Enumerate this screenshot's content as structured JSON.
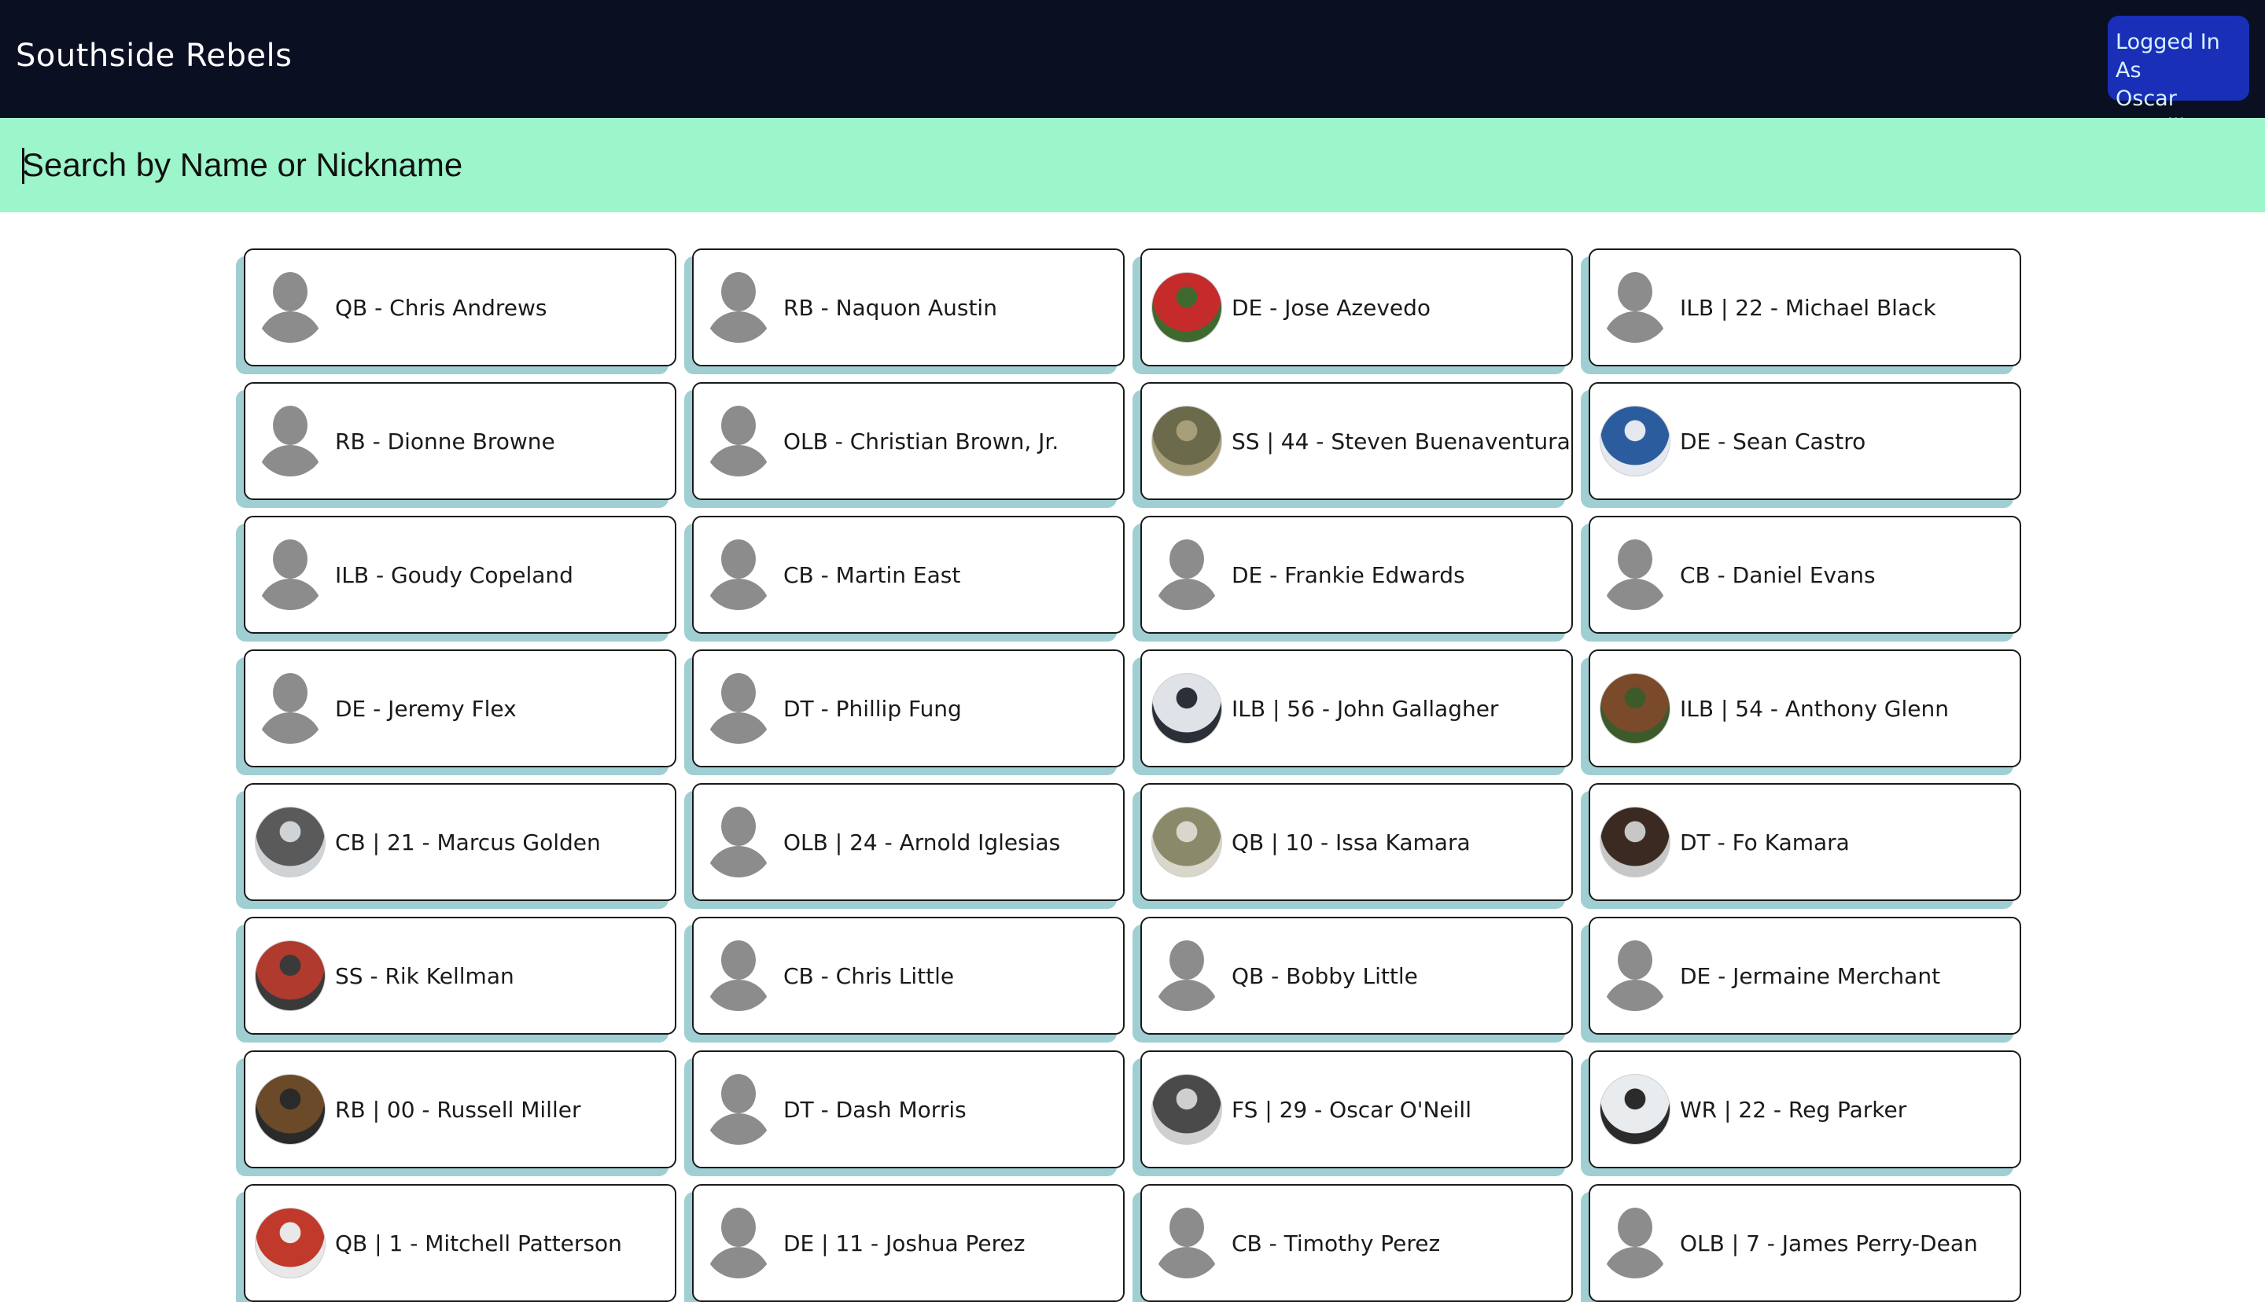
{
  "header": {
    "title": "Southside Rebels",
    "login_line1": "Logged In As",
    "login_line2": "Oscar O'Neill"
  },
  "search": {
    "placeholder": "Search by Name or Nickname",
    "value": ""
  },
  "players": [
    {
      "label": "QB - Chris Andrews",
      "photo": false
    },
    {
      "label": "RB - Naquon Austin",
      "photo": false
    },
    {
      "label": "DE - Jose Azevedo",
      "photo": true,
      "colors": [
        "#c62b2b",
        "#3f6a2f"
      ]
    },
    {
      "label": "ILB | 22 - Michael Black",
      "photo": false
    },
    {
      "label": "RB - Dionne Browne",
      "photo": false
    },
    {
      "label": "OLB - Christian Brown, Jr.",
      "photo": false
    },
    {
      "label": "SS | 44 - Steven Buenaventura",
      "photo": true,
      "colors": [
        "#6b6a4a",
        "#a79f7a"
      ]
    },
    {
      "label": "DE - Sean Castro",
      "photo": true,
      "colors": [
        "#2b5d9e",
        "#e5e8ee"
      ]
    },
    {
      "label": "ILB - Goudy Copeland",
      "photo": false
    },
    {
      "label": "CB - Martin East",
      "photo": false
    },
    {
      "label": "DE - Frankie Edwards",
      "photo": false
    },
    {
      "label": "CB - Daniel Evans",
      "photo": false
    },
    {
      "label": "DE - Jeremy Flex",
      "photo": false
    },
    {
      "label": "DT - Phillip Fung",
      "photo": false
    },
    {
      "label": "ILB | 56 - John Gallagher",
      "photo": true,
      "colors": [
        "#dfe3e8",
        "#2b2f38"
      ]
    },
    {
      "label": "ILB | 54 - Anthony Glenn",
      "photo": true,
      "colors": [
        "#7a4a2a",
        "#3d5a2a"
      ]
    },
    {
      "label": "CB | 21 - Marcus Golden",
      "photo": true,
      "colors": [
        "#5a5a5a",
        "#cfd3d6"
      ]
    },
    {
      "label": "OLB | 24 - Arnold Iglesias",
      "photo": false
    },
    {
      "label": "QB | 10 - Issa Kamara",
      "photo": true,
      "colors": [
        "#8a8a6a",
        "#d9d6cc"
      ]
    },
    {
      "label": "DT - Fo Kamara",
      "photo": true,
      "colors": [
        "#3b2a22",
        "#c7c7c7"
      ]
    },
    {
      "label": "SS - Rik Kellman",
      "photo": true,
      "colors": [
        "#b03a2e",
        "#3a3a3a"
      ]
    },
    {
      "label": "CB - Chris Little",
      "photo": false
    },
    {
      "label": "QB - Bobby Little",
      "photo": false
    },
    {
      "label": "DE - Jermaine Merchant",
      "photo": false
    },
    {
      "label": "RB | 00 - Russell Miller",
      "photo": true,
      "colors": [
        "#6b4a2a",
        "#2a2a2a"
      ]
    },
    {
      "label": "DT - Dash Morris",
      "photo": false
    },
    {
      "label": "FS | 29 - Oscar O'Neill",
      "photo": true,
      "colors": [
        "#4a4a4a",
        "#cfcfcf"
      ]
    },
    {
      "label": "WR | 22 - Reg Parker",
      "photo": true,
      "colors": [
        "#e9ecef",
        "#2b2b2b"
      ]
    },
    {
      "label": "QB | 1 - Mitchell Patterson",
      "photo": true,
      "colors": [
        "#c0392b",
        "#e8e8e8"
      ]
    },
    {
      "label": "DE | 11 - Joshua Perez",
      "photo": false
    },
    {
      "label": "CB - Timothy Perez",
      "photo": false
    },
    {
      "label": "OLB | 7 - James Perry-Dean",
      "photo": false
    }
  ]
}
